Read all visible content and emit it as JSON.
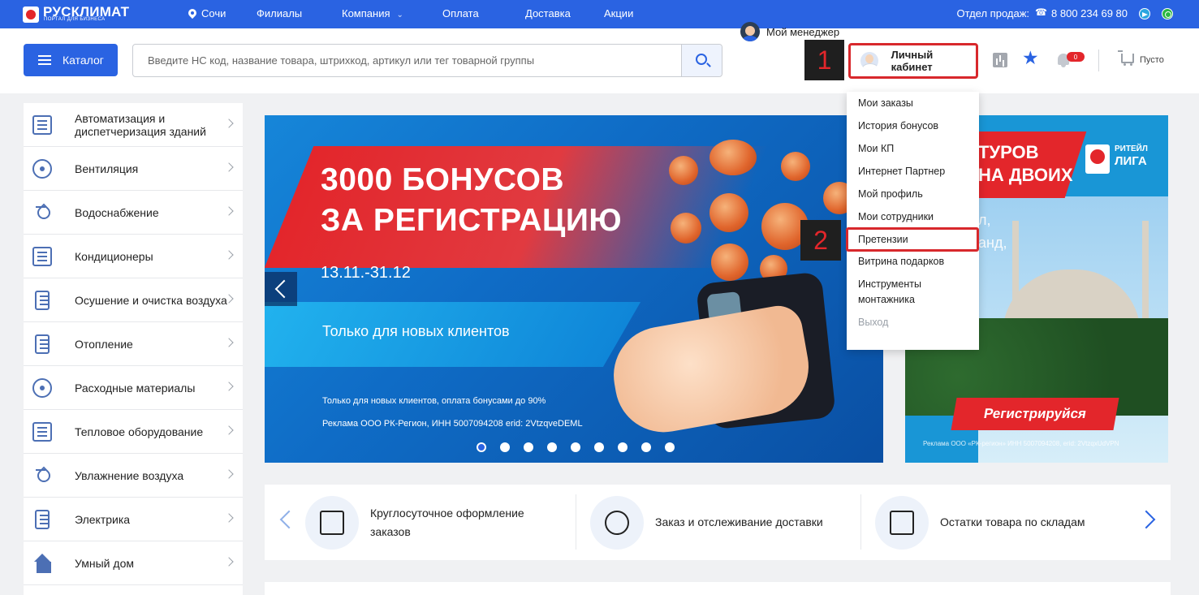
{
  "topbar": {
    "logo_name": "РУСКЛИМАТ",
    "logo_sub": "ПОРТАЛ ДЛЯ БИЗНЕСА",
    "city": "Сочи",
    "nav": [
      "Филиалы",
      "Компания",
      "Оплата",
      "Доставка",
      "Акции"
    ],
    "sales_label": "Отдел продаж:",
    "phone": "8 800 234 69 80"
  },
  "header": {
    "catalog_label": "Каталог",
    "search_placeholder": "Введите НС код, название товара, штрихкод, артикул или тег товарной группы",
    "manager_label": "Мой менеджер",
    "account_label": "Личный кабинет",
    "notifications_badge": "0",
    "cart_label": "Пусто"
  },
  "markers": [
    "1",
    "2"
  ],
  "sidebar": {
    "items": [
      {
        "label": "Автоматизация и диспетчеризация зданий",
        "icon": "building-automation-icon"
      },
      {
        "label": "Вентиляция",
        "icon": "fan-icon"
      },
      {
        "label": "Водоснабжение",
        "icon": "faucet-icon"
      },
      {
        "label": "Кондиционеры",
        "icon": "air-conditioner-icon"
      },
      {
        "label": "Осушение и очистка воздуха",
        "icon": "dehumidifier-icon"
      },
      {
        "label": "Отопление",
        "icon": "radiator-icon"
      },
      {
        "label": "Расходные материалы",
        "icon": "gear-icon"
      },
      {
        "label": "Тепловое оборудование",
        "icon": "heater-icon"
      },
      {
        "label": "Увлажнение воздуха",
        "icon": "humidifier-icon"
      },
      {
        "label": "Электрика",
        "icon": "electric-panel-icon"
      },
      {
        "label": "Умный дом",
        "icon": "smart-home-icon"
      }
    ]
  },
  "banner": {
    "title_line1": "3000 БОНУСОВ",
    "title_line2": "ЗА РЕГИСТРАЦИЮ",
    "date": "13.11.-31.12",
    "subtitle": "Только для новых клиентов",
    "fine1": "Только для новых клиентов, оплата бонусами до 90%",
    "fine2": "Реклама ООО РК-Регион, ИНН 5007094208 erid: 2VtzqveDEML",
    "slide_count": 9,
    "active_slide": 1
  },
  "banner2": {
    "title_line1": "ТУРОВ",
    "title_line2": "НА ДВОИХ",
    "text_line1": "л,",
    "text_line2": "анд,",
    "logo_t1": "РИТЕЙЛ",
    "logo_t2": "ЛИГА",
    "cta": "Регистрируйся",
    "fine": "Реклама ООО «РК-регион» ИНН 5007094208, erid: 2VtzqxUdVPN"
  },
  "dropdown": {
    "items": [
      {
        "label": "Мои заказы"
      },
      {
        "label": "История бонусов"
      },
      {
        "label": "Мои КП"
      },
      {
        "label": "Интернет Партнер"
      },
      {
        "label": "Мой профиль"
      },
      {
        "label": "Мои сотрудники"
      },
      {
        "label": "Претензии"
      },
      {
        "label": "Витрина подарков"
      },
      {
        "label": "Инструменты монтажника"
      },
      {
        "label": "Выход"
      }
    ]
  },
  "features": {
    "items": [
      {
        "label": "Круглосуточное оформление заказов",
        "icon": "store-icon"
      },
      {
        "label": "Заказ и отслеживание доставки",
        "icon": "delivery-truck-icon"
      },
      {
        "label": "Остатки товара по складам",
        "icon": "cart-icon"
      }
    ]
  },
  "colors": {
    "brand_blue": "#2a63e2",
    "accent_red": "#e3262b",
    "highlight_red": "#d8282c"
  }
}
